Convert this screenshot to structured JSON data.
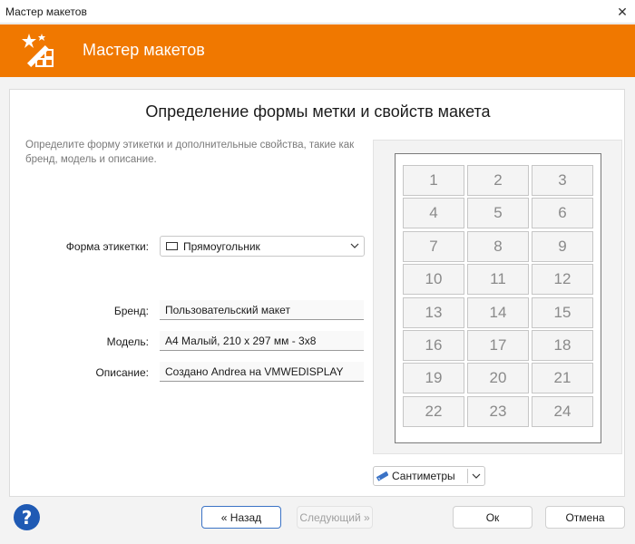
{
  "window": {
    "title": "Мастер макетов",
    "close_glyph": "✕"
  },
  "banner": {
    "title": "Мастер макетов",
    "icon": "wand-grid-icon",
    "color": "#f07800"
  },
  "page": {
    "heading": "Определение формы метки и свойств макета",
    "description": "Определите форму этикетки и дополнительные свойства, такие как бренд, модель и описание."
  },
  "form": {
    "shape_label": "Форма этикетки:",
    "shape_value": "Прямоугольник",
    "brand_label": "Бренд:",
    "brand_value": "Пользовательский макет",
    "model_label": "Модель:",
    "model_value": "A4 Малый, 210 x 297 мм - 3x8",
    "description_label": "Описание:",
    "description_value": "Создано Andrea на VMWEDISPLAY"
  },
  "preview": {
    "columns": 3,
    "rows": 8,
    "labels": [
      "1",
      "2",
      "3",
      "4",
      "5",
      "6",
      "7",
      "8",
      "9",
      "10",
      "11",
      "12",
      "13",
      "14",
      "15",
      "16",
      "17",
      "18",
      "19",
      "20",
      "21",
      "22",
      "23",
      "24"
    ]
  },
  "units": {
    "value": "Сантиметры"
  },
  "footer": {
    "help_glyph": "?",
    "back_label": "« Назад",
    "next_label": "Следующий »",
    "ok_label": "Ок",
    "cancel_label": "Отмена"
  }
}
